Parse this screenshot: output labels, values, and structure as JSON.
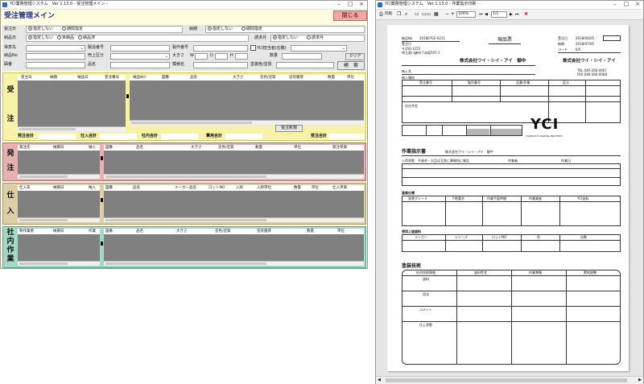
{
  "left": {
    "window_title": "YCI業務管理システム　Ver 1.13.0 - 受注管理メイン -",
    "page_title": "受注管理メイン",
    "close_label": "閉じる",
    "filters": {
      "order_date": "受注日",
      "r_unspecified": "指定しない",
      "r_period": "期間指定",
      "due_date": "納期",
      "r2_unspecified": "指定しない",
      "r2_period": "期間指定",
      "delivery_date": "納品日",
      "r3_unspecified": "指定しない",
      "r3_undelivered": "未納品",
      "r3_delivered": "納品済",
      "request_month": "請求月",
      "r4_unspecified": "指定しない",
      "r4_request": "請求月",
      "customer": "得意先",
      "mfg_no": "製造番号",
      "mfg_date": "製作番号",
      "yci_cb": "YCI担当者(在籍)",
      "delivery_no": "納品No",
      "sales_cat": "売上区分",
      "size": "大きさ",
      "w": "W",
      "d": "D",
      "h": "H",
      "qty": "数量",
      "clear": "クリア",
      "drawing": "図番",
      "product": "品名",
      "model": "模様名",
      "paint": "塗装色/塗質",
      "search": "検　索"
    },
    "order": {
      "title": "受注",
      "cols_left": [
        "受注日",
        "納期",
        "納品日",
        "受注番号"
      ],
      "cols_right": [
        "納品NO",
        "図番",
        "品名",
        "大きさ",
        "塗色/塗質",
        "塗装膜厚",
        "数量",
        "単位"
      ],
      "new_button": "受注新規",
      "sums": [
        "発注合計",
        "仕入合計",
        "社内合計",
        "費用合計",
        "受注合計"
      ]
    },
    "hatchu": {
      "title": "発注",
      "cols_left": [
        "発注先",
        "納期日",
        "納入"
      ],
      "cols_right": [
        "図番",
        "品名",
        "大きさ",
        "塗色/塗質",
        "数量",
        "単位",
        "発注単価"
      ]
    },
    "shiire": {
      "title": "仕入",
      "cols_left": [
        "仕入先",
        "納期日",
        "納入"
      ],
      "cols_right": [
        "図番",
        "品名",
        "メーカー品名",
        "ロットNO",
        "入財",
        "入財単位",
        "数量",
        "単位",
        "仕入単価"
      ]
    },
    "shanai": {
      "title": "社内作業",
      "cols_left": [
        "製作業者",
        "納期日",
        "作業"
      ],
      "cols_right": [
        "図番",
        "品名",
        "大きさ",
        "塗色/塗質",
        "塗装膜厚",
        "数量",
        "単位"
      ]
    }
  },
  "right": {
    "window_title": "YCI業務管理システム　Ver 1.13.0 - 作業指示印刷 -",
    "zoom": "100%",
    "page_num": "1/1",
    "paper": {
      "doc_title": "現品票",
      "no_label": "納品No",
      "no_value": "20180702-0211",
      "date_label": "受注日",
      "date_value": "2018/06/05",
      "due_label": "納期",
      "due_value": "2018/07/05",
      "code_label": "コード",
      "code_value": "6/5",
      "addr1": "〒350-1155",
      "addr2": "埼玉県川越市下赤坂597-1",
      "company": "株式会社ワイ・シイ・アイ　御中",
      "company_right": "株式会社ワイ・シイ・アイ",
      "tel": "TEL 049-266-0067",
      "fax": "FAX 049-266-0068",
      "s1": "納入先",
      "s2": "納入場所",
      "t1": [
        "受注番号",
        "製作番号",
        "品番/作業",
        "区分"
      ],
      "in_house": "社内予定",
      "logo": "YCI",
      "logo_sub": "YOKOUCHI COATING INDUSTRY",
      "work_title": "作業指示書",
      "work_customer": "株式会社ワイ・シイ・アイ　御中",
      "work_person": "作業者",
      "work_date": "作業日",
      "work_line": "入荷状態　不具合・欠品は至急に事務所に報告",
      "paint_spec": "塗装仕様",
      "paint_cols": [
        "塗装グレード",
        "下地要求",
        "作業手配時間",
        "作業業者",
        "YCI塗料"
      ],
      "use_paint": "使用上塗塗料",
      "use_cols": [
        "メーカー",
        "シリーズ",
        "ロットNO",
        "色",
        "缶数"
      ],
      "tech": "塗装技術",
      "tech_cols": [
        "社内技術情報",
        "塗料性状",
        "作業準備",
        "素地調整"
      ],
      "tech_rows": [
        "塗料",
        "用法",
        "コメント",
        "仕上状態"
      ]
    }
  }
}
